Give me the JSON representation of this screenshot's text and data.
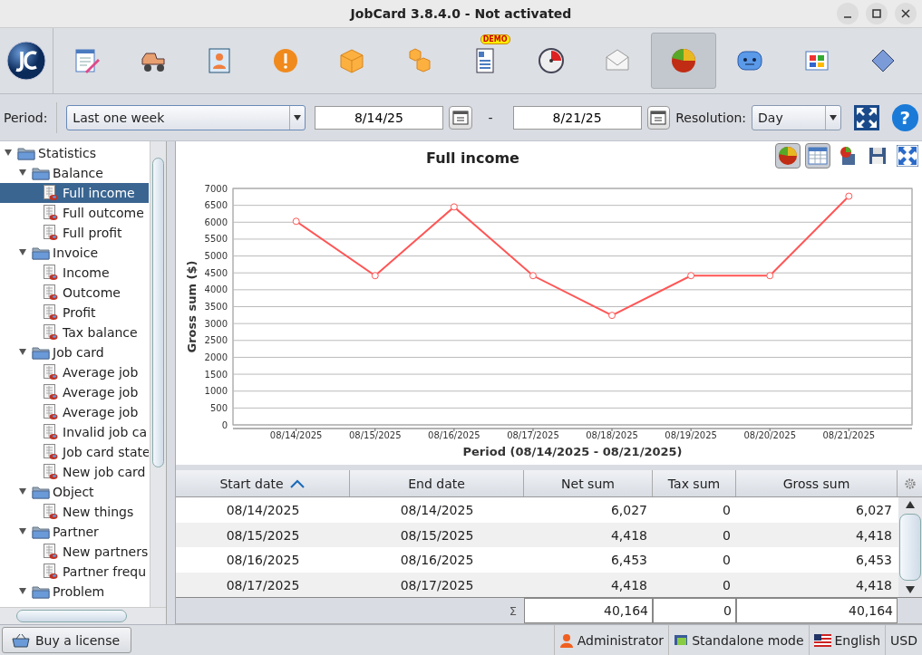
{
  "window": {
    "title": "JobCard 3.8.4.0 - Not activated"
  },
  "toolbar": {
    "buttons": [
      {
        "selected": false
      },
      {
        "selected": false
      },
      {
        "selected": false
      },
      {
        "selected": false
      },
      {
        "selected": false
      },
      {
        "selected": false
      },
      {
        "selected": false,
        "badge": "DEMO"
      },
      {
        "selected": false
      },
      {
        "selected": false
      },
      {
        "selected": true
      },
      {
        "selected": false
      },
      {
        "selected": false
      },
      {
        "selected": false
      }
    ]
  },
  "period_bar": {
    "period_label": "Period:",
    "period_value": "Last one week",
    "date_from": "8/14/25",
    "separator": "-",
    "date_to": "8/21/25",
    "resolution_label": "Resolution:",
    "resolution_value": "Day",
    "help": "?"
  },
  "tree": [
    {
      "label": "Statistics",
      "expanded": true,
      "children": [
        {
          "label": "Balance",
          "expanded": true,
          "children": [
            {
              "label": "Full income",
              "selected": true
            },
            {
              "label": "Full outcome",
              "selected": false
            },
            {
              "label": "Full profit",
              "selected": false
            }
          ]
        },
        {
          "label": "Invoice",
          "expanded": true,
          "children": [
            {
              "label": "Income",
              "selected": false
            },
            {
              "label": "Outcome",
              "selected": false
            },
            {
              "label": "Profit",
              "selected": false
            },
            {
              "label": "Tax balance",
              "selected": false
            }
          ]
        },
        {
          "label": "Job card",
          "expanded": true,
          "children": [
            {
              "label": "Average job",
              "selected": false
            },
            {
              "label": "Average job",
              "selected": false
            },
            {
              "label": "Average job",
              "selected": false
            },
            {
              "label": "Invalid job ca",
              "selected": false
            },
            {
              "label": "Job card state",
              "selected": false
            },
            {
              "label": "New job card",
              "selected": false
            }
          ]
        },
        {
          "label": "Object",
          "expanded": true,
          "children": [
            {
              "label": "New things",
              "selected": false
            }
          ]
        },
        {
          "label": "Partner",
          "expanded": true,
          "children": [
            {
              "label": "New partners",
              "selected": false
            },
            {
              "label": "Partner frequ",
              "selected": false
            }
          ]
        },
        {
          "label": "Problem",
          "expanded": true
        }
      ]
    }
  ],
  "chart": {
    "chart_data": {
      "type": "line",
      "title": "Full income",
      "xlabel": "Period (08/14/2025 - 08/21/2025)",
      "ylabel": "Gross sum ($)",
      "categories": [
        "08/14/2025",
        "08/15/2025",
        "08/16/2025",
        "08/17/2025",
        "08/18/2025",
        "08/19/2025",
        "08/20/2025",
        "08/21/2025"
      ],
      "series": [
        {
          "color": "#ff5555",
          "marker": "circle",
          "values": [
            6027,
            4418,
            6453,
            4418,
            3242,
            4418,
            4418,
            6770
          ]
        }
      ],
      "grid": true,
      "ylim": [
        0,
        7000
      ],
      "yticks": [
        0,
        500,
        1000,
        1500,
        2000,
        2500,
        3000,
        3500,
        4000,
        4500,
        5000,
        5500,
        6000,
        6500,
        7000
      ]
    },
    "view_buttons": [
      {
        "selected": true
      },
      {
        "selected": true
      },
      {
        "selected": false
      },
      {
        "selected": false
      },
      {
        "selected": false
      }
    ]
  },
  "table": {
    "columns": [
      {
        "label": "Start date",
        "sorted": true
      },
      {
        "label": "End date",
        "sorted": false
      },
      {
        "label": "Net sum",
        "sorted": false
      },
      {
        "label": "Tax sum",
        "sorted": false
      },
      {
        "label": "Gross sum",
        "sorted": false
      }
    ],
    "rows": [
      [
        "08/14/2025",
        "08/14/2025",
        "6,027",
        "0",
        "6,027"
      ],
      [
        "08/15/2025",
        "08/15/2025",
        "4,418",
        "0",
        "4,418"
      ],
      [
        "08/16/2025",
        "08/16/2025",
        "6,453",
        "0",
        "6,453"
      ],
      [
        "08/17/2025",
        "08/17/2025",
        "4,418",
        "0",
        "4,418"
      ]
    ],
    "sum_label": "Σ",
    "totals": [
      "40,164",
      "0",
      "40,164"
    ]
  },
  "status_bar": {
    "license_button": "Buy a license",
    "user": "Administrator",
    "mode": "Standalone mode",
    "language": "English",
    "currency": "USD"
  }
}
